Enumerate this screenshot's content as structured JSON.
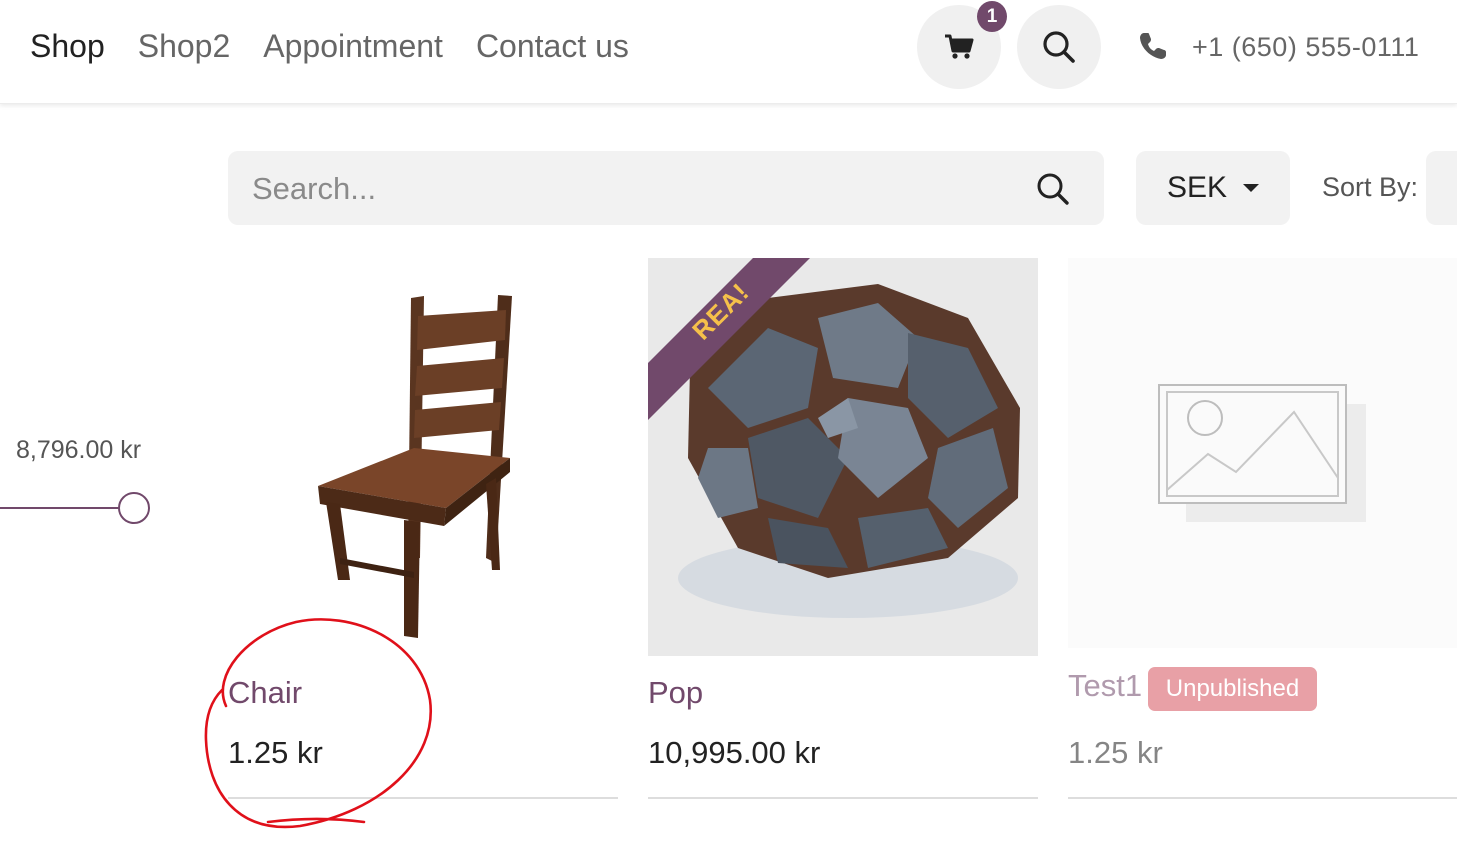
{
  "nav": {
    "items": [
      {
        "label": "Shop",
        "active": true
      },
      {
        "label": "Shop2",
        "active": false
      },
      {
        "label": "Appointment",
        "active": false
      },
      {
        "label": "Contact us",
        "active": false
      }
    ],
    "cart_count": "1",
    "phone": "+1 (650) 555-0111"
  },
  "toolbar": {
    "search_placeholder": "Search...",
    "currency": "SEK",
    "sort_label": "Sort By:"
  },
  "filter": {
    "price_max_label": "8,796.00 kr"
  },
  "products": [
    {
      "name": "Chair",
      "price": "1.25 kr"
    },
    {
      "name": "Pop",
      "price": "10,995.00 kr",
      "ribbon": "REA!"
    },
    {
      "name": "Test1",
      "price": "1.25 kr",
      "status": "Unpublished"
    }
  ],
  "colors": {
    "accent": "#71496b",
    "ribbon_text": "#f5c04a",
    "unpublished_badge": "#e8a0a6",
    "annotation": "#e0101a"
  },
  "icons": [
    "cart-icon",
    "search-icon",
    "phone-icon",
    "image-placeholder-icon"
  ]
}
